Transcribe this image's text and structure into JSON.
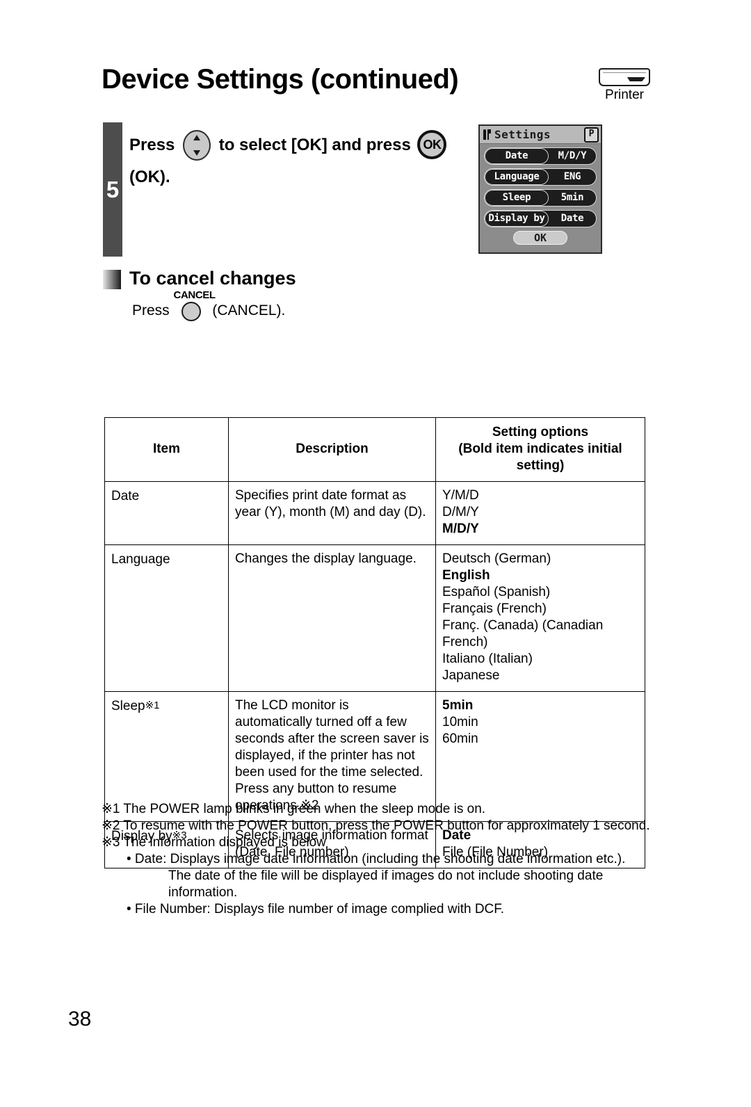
{
  "header": {
    "title": "Device Settings (continued)",
    "device_badge": {
      "icon": "printer-icon",
      "label": "Printer"
    }
  },
  "step": {
    "number": "5",
    "text_before_nav": "Press",
    "nav_icon": "nav-updown-button-icon",
    "text_after_nav": "to select [OK] and press",
    "ok_icon_label": "OK",
    "text_tail": "(OK)."
  },
  "lcd": {
    "icon": "settings-wrench-icon",
    "title": "Settings",
    "mode_badge": "P",
    "rows": [
      {
        "label": "Date",
        "value": "M/D/Y"
      },
      {
        "label": "Language",
        "value": "ENG"
      },
      {
        "label": "Sleep",
        "value": "5min"
      },
      {
        "label": "Display by",
        "value": "Date"
      }
    ],
    "ok_button": "OK"
  },
  "cancel_section": {
    "heading": "To cancel changes",
    "press_label": "Press",
    "button_caption": "CANCEL",
    "trailing_text": "(CANCEL)."
  },
  "table": {
    "headers": {
      "item": "Item",
      "description": "Description",
      "options_line1": "Setting options",
      "options_line2": "(Bold item indicates initial setting)"
    },
    "rows": [
      {
        "item": "Date",
        "item_mark": "",
        "description": "Specifies print date format as year (Y), month (M) and day (D).",
        "options": [
          {
            "text": "Y/M/D",
            "bold": false
          },
          {
            "text": "D/M/Y",
            "bold": false
          },
          {
            "text": "M/D/Y",
            "bold": true
          }
        ]
      },
      {
        "item": "Language",
        "item_mark": "",
        "description": "Changes the display language.",
        "options": [
          {
            "text": "Deutsch (German)",
            "bold": false
          },
          {
            "text": "English",
            "bold": true
          },
          {
            "text": "Español (Spanish)",
            "bold": false
          },
          {
            "text": "Français (French)",
            "bold": false
          },
          {
            "text": "Franç. (Canada) (Canadian French)",
            "bold": false
          },
          {
            "text": "Italiano (Italian)",
            "bold": false
          },
          {
            "text": "Japanese",
            "bold": false
          }
        ]
      },
      {
        "item": "Sleep",
        "item_mark": "※1",
        "description": "The LCD monitor is automatically turned off a few seconds after the screen saver is displayed, if the printer has not been used for the time selected. Press any button to resume operations.※2",
        "options": [
          {
            "text": "5min",
            "bold": true
          },
          {
            "text": "10min",
            "bold": false
          },
          {
            "text": "60min",
            "bold": false
          }
        ]
      },
      {
        "item": "Display by",
        "item_mark": "※3",
        "description": "Selects image information format (Date, File number)",
        "options": [
          {
            "text": "Date",
            "bold": true
          },
          {
            "text": "File (File Number)",
            "bold": false
          }
        ]
      }
    ]
  },
  "footnotes": {
    "note1": "※1 The POWER lamp blinks in green when the sleep mode is on.",
    "note2": "※2 To resume with the POWER button, press the POWER button for approximately 1 second.",
    "note3": "※3 The information displayed is below",
    "bullet1": "• Date: Displays image date information (including the shooting date information etc.).",
    "bullet1_cont_a": "The date of the file will be displayed if images do not include shooting date",
    "bullet1_cont_b": "information.",
    "bullet2": "• File Number: Displays file number of image complied with DCF."
  },
  "page_number": "38"
}
